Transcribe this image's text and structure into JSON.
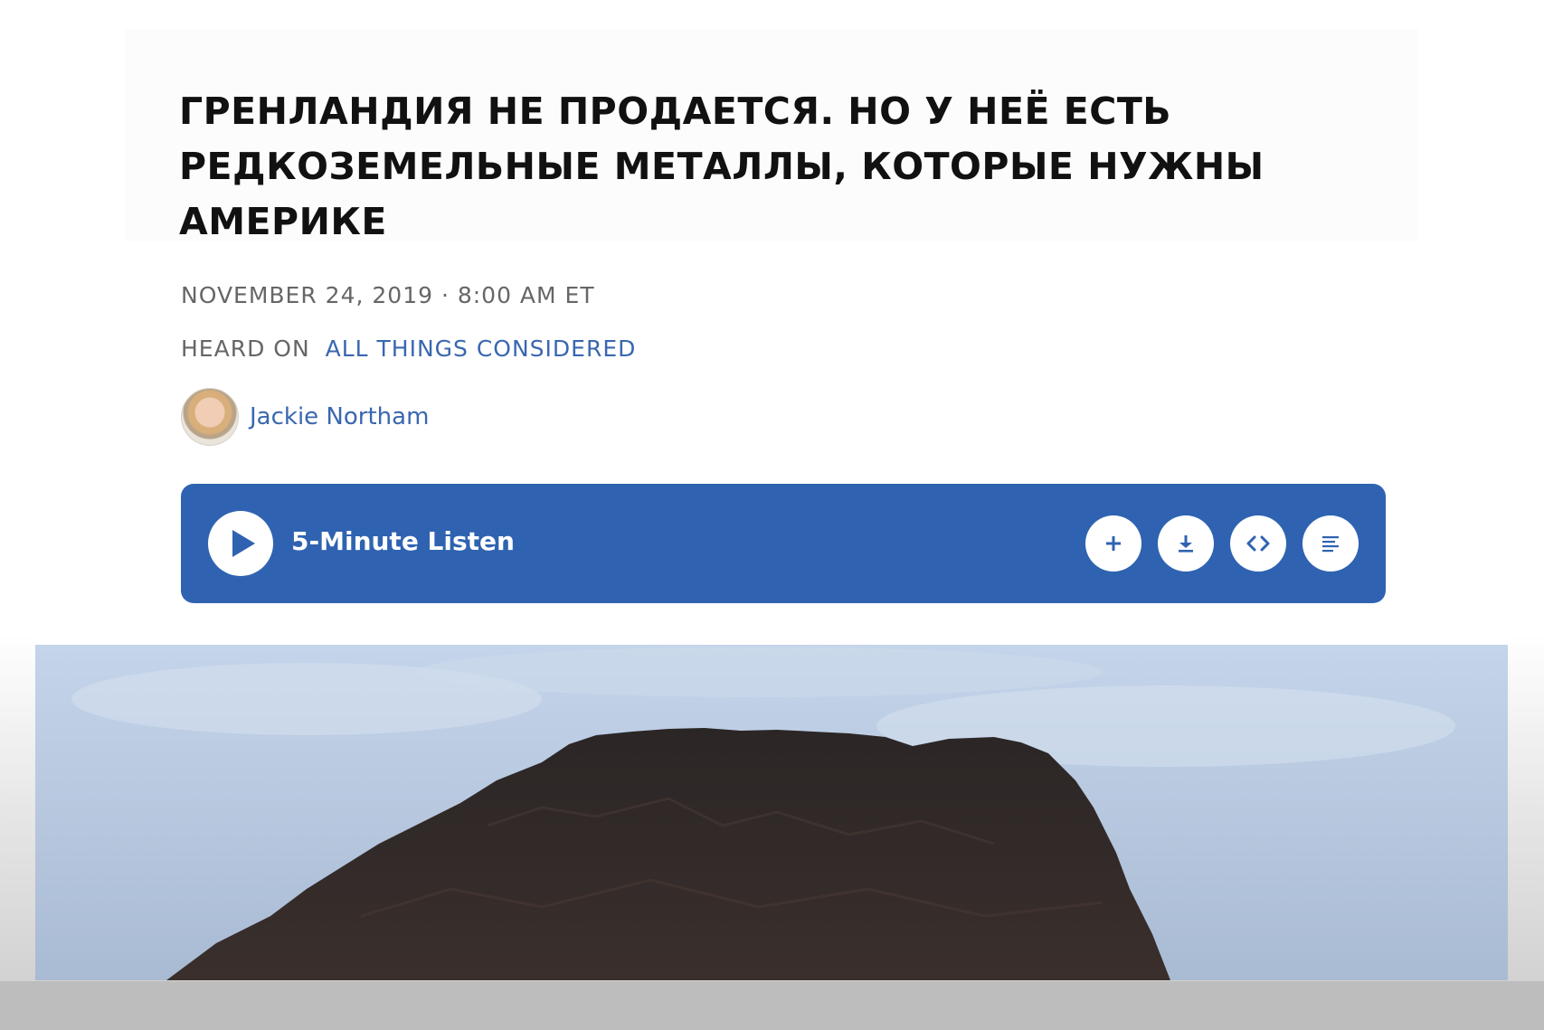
{
  "article": {
    "headline": "Гренландия не продается. Но у неё есть редкоземельные металлы, которые нужны Америке",
    "dateline": "NOVEMBER 24, 2019 · 8:00 AM ET",
    "heard_on_prefix": "HEARD ON",
    "program": "ALL THINGS CONSIDERED",
    "author": "Jackie Northam"
  },
  "player": {
    "label": "5-Minute Listen",
    "actions": [
      "add-icon",
      "download-icon",
      "embed-icon",
      "transcript-icon"
    ]
  },
  "colors": {
    "accent": "#2f63b1",
    "link": "#3a67b0",
    "headline": "#111111",
    "meta": "#666666"
  },
  "hero_image": {
    "subject": "dark rocky mountain against cloudy sky"
  }
}
